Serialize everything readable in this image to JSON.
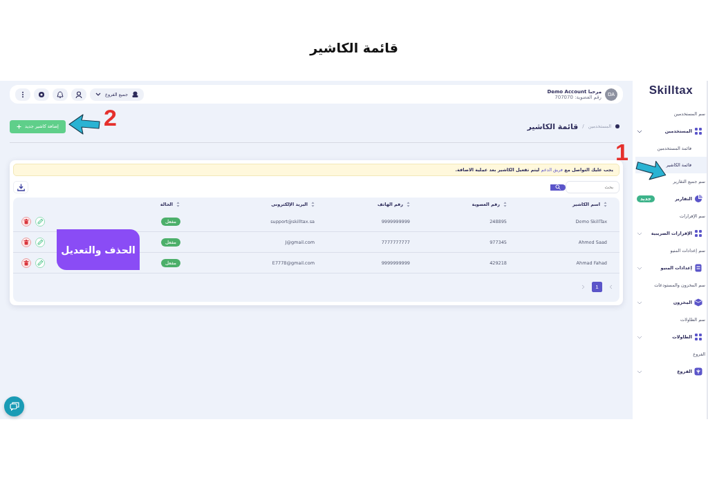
{
  "page_title": "قائمة الكاشير",
  "sidebar": {
    "logo": "Skilltax",
    "sections": [
      {
        "heading": "سم المستخدمين",
        "item": {
          "label": "المستخدمين",
          "kind": "group",
          "expanded": true,
          "children": [
            {
              "label": "قائمة المستخدمين",
              "selected": false
            },
            {
              "label": "قائمة الكاشير",
              "selected": true
            }
          ]
        }
      },
      {
        "heading": "سم جميع التقارير",
        "item": {
          "label": "التقارير",
          "kind": "link",
          "badge": "جديد"
        }
      },
      {
        "heading": "سم الإقرارات",
        "item": {
          "label": "الإقرارات الضريبية",
          "kind": "group",
          "expanded": false
        }
      },
      {
        "heading": "سم إعدادات المنيو",
        "item": {
          "label": "إعدادات المنيو",
          "kind": "group",
          "expanded": false
        }
      },
      {
        "heading": "سم المخزون والمستودعات",
        "item": {
          "label": "المخزون",
          "kind": "group",
          "expanded": false
        }
      },
      {
        "heading": "سم الطاولات",
        "item": {
          "label": "الطاولات",
          "kind": "group",
          "expanded": false
        }
      },
      {
        "heading": "الفروع",
        "item": {
          "label": "الفروع",
          "kind": "group",
          "expanded": false
        }
      }
    ]
  },
  "header": {
    "avatar": "DA",
    "greeting": "مرحبا Demo Account",
    "member_no": "رقم العضوية: 707070",
    "branch_select": "جميع الفروع"
  },
  "breadcrumb": {
    "parent": "المستخدمين",
    "separator": "/",
    "current": "قائمة الكاشير"
  },
  "add_button": "إضافة كاشير جديد",
  "notice": {
    "before": "يجب عليك التواصل مع",
    "link": "فريق الدعم",
    "after": "ليتم تفعيل الكاشير بعد عملية الاضافة."
  },
  "search": {
    "placeholder": "بحث"
  },
  "table": {
    "columns": [
      "اسم الكاشير",
      "رقم العضوية",
      "رقم الهاتف",
      "البريد الإلكتروني",
      "الحالة"
    ],
    "rows": [
      {
        "cells": [
          "Demo SkillTax",
          "248895",
          "9999999999",
          "support@skilltax.sa"
        ],
        "status": "مفعل"
      },
      {
        "cells": [
          "Ahmed Saad",
          "977345",
          "7777777777",
          "J@gmail.com"
        ],
        "status": "مفعل"
      },
      {
        "cells": [
          "Ahmad Fahad",
          "429218",
          "9999999999",
          "E7778@gmail.com"
        ],
        "status": "مفعل"
      }
    ]
  },
  "pagination": [
    {
      "label": "1",
      "selected": true
    }
  ],
  "annotations": [
    {
      "kind": "step",
      "text": "1"
    },
    {
      "kind": "step",
      "text": "2"
    },
    {
      "kind": "label",
      "text": "الحذف والتعديل"
    }
  ]
}
